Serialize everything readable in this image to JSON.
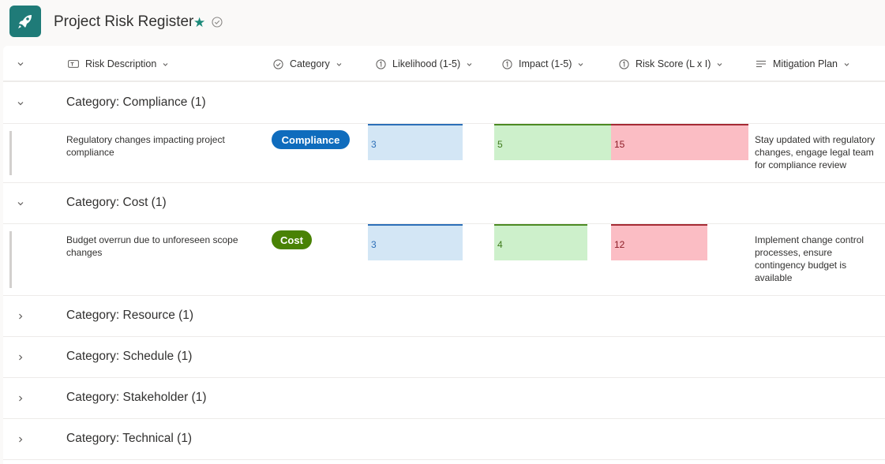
{
  "app": {
    "title": "Project Risk Register",
    "icon": "rocket-icon",
    "accent": "#1f7b78"
  },
  "columns": [
    {
      "label": "Risk Description",
      "icon": "text-field-icon"
    },
    {
      "label": "Category",
      "icon": "choice-check-icon"
    },
    {
      "label": "Likelihood (1-5)",
      "icon": "number-icon"
    },
    {
      "label": "Impact (1-5)",
      "icon": "number-icon"
    },
    {
      "label": "Risk Score (L x I)",
      "icon": "number-icon"
    },
    {
      "label": "Mitigation Plan",
      "icon": "multiline-text-icon"
    }
  ],
  "groups": [
    {
      "label": "Category: Compliance (1)",
      "expanded": true,
      "items": [
        {
          "description": "Regulatory changes impacting project compliance",
          "category": "Compliance",
          "category_color": "#0f6cbd",
          "likelihood": "3",
          "impact": "5",
          "risk_score": "15",
          "mitigation": "Stay updated with regulatory changes, engage legal team for compliance review"
        }
      ]
    },
    {
      "label": "Category: Cost (1)",
      "expanded": true,
      "items": [
        {
          "description": "Budget overrun due to unforeseen scope changes",
          "category": "Cost",
          "category_color": "#498205",
          "likelihood": "3",
          "impact": "4",
          "risk_score": "12",
          "mitigation": "Implement change control processes, ensure contingency budget is available"
        }
      ]
    },
    {
      "label": "Category: Resource (1)",
      "expanded": false
    },
    {
      "label": "Category: Schedule (1)",
      "expanded": false
    },
    {
      "label": "Category: Stakeholder (1)",
      "expanded": false
    },
    {
      "label": "Category: Technical (1)",
      "expanded": false
    }
  ]
}
